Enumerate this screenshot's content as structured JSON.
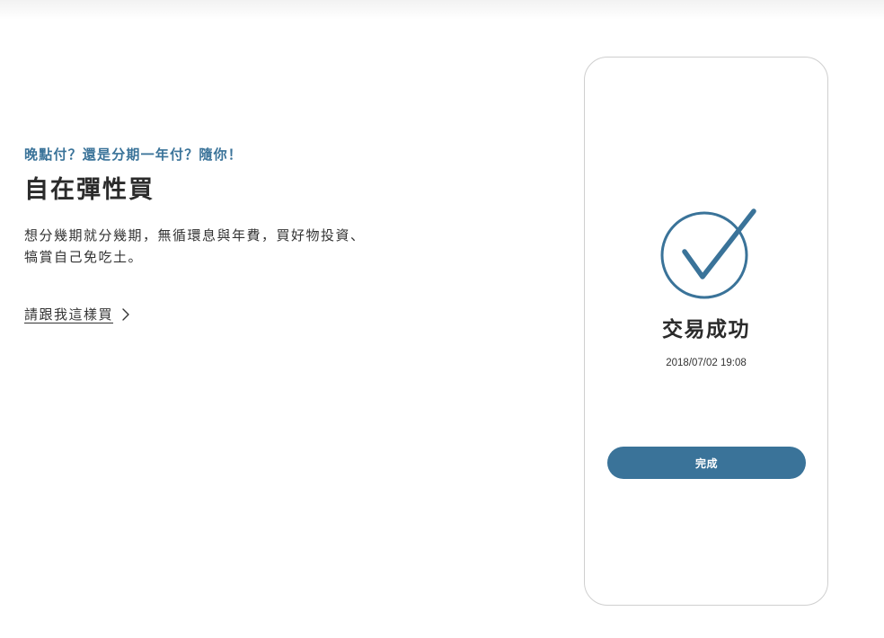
{
  "feature": {
    "eyebrow": "晚點付？還是分期一年付？隨你！",
    "headline": "自在彈性買",
    "description": "想分幾期就分幾期，無循環息與年費，買好物投資、犒賞自己免吃土。",
    "cta_label": "請跟我這樣買",
    "cta_icon": "chevron-right-icon"
  },
  "phone": {
    "success_icon": "check-circle-icon",
    "title": "交易成功",
    "timestamp": "2018/07/02 19:08",
    "button_label": "完成"
  },
  "colors": {
    "accent": "#3a7399",
    "text": "#2b2b2b",
    "frame_border": "#cfcfcf"
  }
}
